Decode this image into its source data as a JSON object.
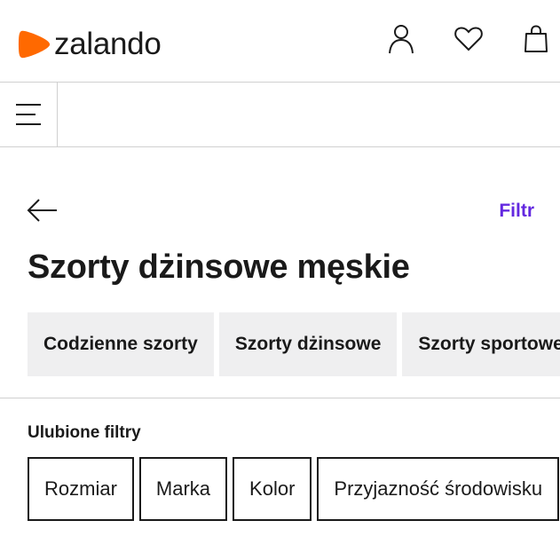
{
  "header": {
    "brand": "zalando",
    "brand_color": "#ff6900",
    "icons": [
      "user-icon",
      "heart-icon",
      "bag-icon"
    ]
  },
  "nav": {
    "menu_icon": "hamburger-icon"
  },
  "toolbar": {
    "back_icon": "arrow-left-icon",
    "filter_label": "Filtr",
    "filter_color": "#6328e0"
  },
  "page": {
    "title": "Szorty dżinsowe męskie"
  },
  "categories": [
    {
      "label": "Codzienne szorty"
    },
    {
      "label": "Szorty dżinsowe"
    },
    {
      "label": "Szorty sportowe"
    }
  ],
  "favorites": {
    "label": "Ulubione filtry",
    "filters": [
      {
        "label": "Rozmiar"
      },
      {
        "label": "Marka"
      },
      {
        "label": "Kolor"
      },
      {
        "label": "Przyjazność środowisku"
      }
    ]
  }
}
